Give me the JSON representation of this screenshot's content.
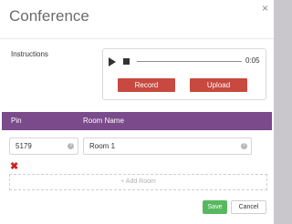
{
  "dialog": {
    "title": "Conference",
    "close_icon": "×"
  },
  "instructions": {
    "label": "Instructions",
    "time": "0:05",
    "record_label": "Record",
    "upload_label": "Upload"
  },
  "table": {
    "headers": {
      "pin": "Pin",
      "room_name": "Room Name"
    },
    "rows": [
      {
        "pin": "5179",
        "room_name": "Room 1"
      }
    ]
  },
  "add_room_label": "+ Add Room",
  "footer": {
    "save_label": "Save",
    "cancel_label": "Cancel"
  },
  "colors": {
    "accent_purple": "#7a4a8a",
    "record_red": "#c8493f",
    "save_green": "#58b85f",
    "delete_red": "#cc2222"
  }
}
